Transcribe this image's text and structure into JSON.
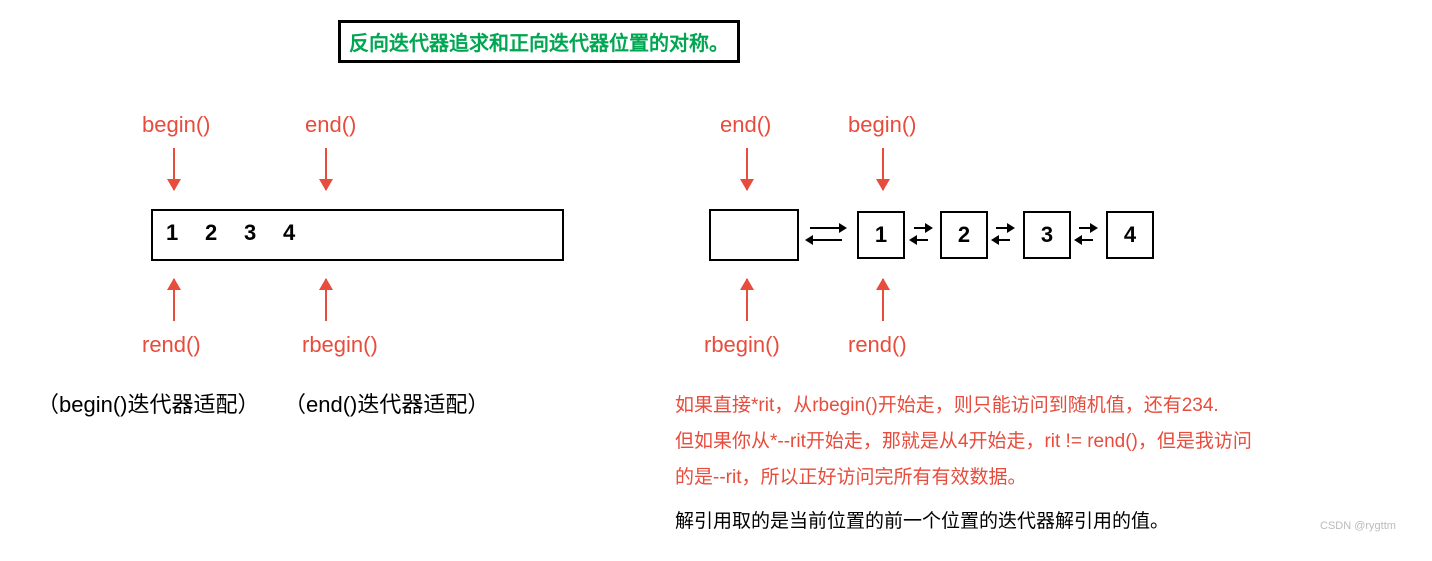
{
  "title": "反向迭代器追求和正向迭代器位置的对称。",
  "left": {
    "begin": "begin()",
    "end": "end()",
    "rend": "rend()",
    "rbegin": "rbegin()",
    "begin_adapt": "（begin()迭代器适配）",
    "end_adapt": "（end()迭代器适配）",
    "items": [
      "1",
      "2",
      "3",
      "4"
    ]
  },
  "right": {
    "end": "end()",
    "begin": "begin()",
    "rbegin": "rbegin()",
    "rend": "rend()",
    "nodes": [
      "1",
      "2",
      "3",
      "4"
    ]
  },
  "explain": {
    "line1": "如果直接*rit，从rbegin()开始走，则只能访问到随机值，还有234.",
    "line2": "但如果你从*--rit开始走，那就是从4开始走，rit != rend()，但是我访问",
    "line3": "的是--rit，所以正好访问完所有有效数据。",
    "line4": "解引用取的是当前位置的前一个位置的迭代器解引用的值。"
  },
  "watermark": "CSDN @rygttm"
}
